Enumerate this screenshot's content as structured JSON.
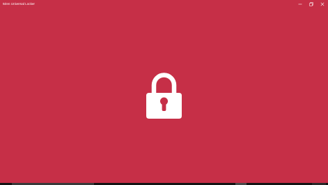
{
  "window": {
    "title": "9Zen Universal Locker",
    "background_color": "#c62f47",
    "buttons": {
      "minimize_icon": "minimize-icon",
      "maximize_icon": "maximize-icon",
      "close_icon": "close-icon"
    }
  },
  "main": {
    "lock_icon": "padlock-icon",
    "lock_color": "#ffffff"
  }
}
